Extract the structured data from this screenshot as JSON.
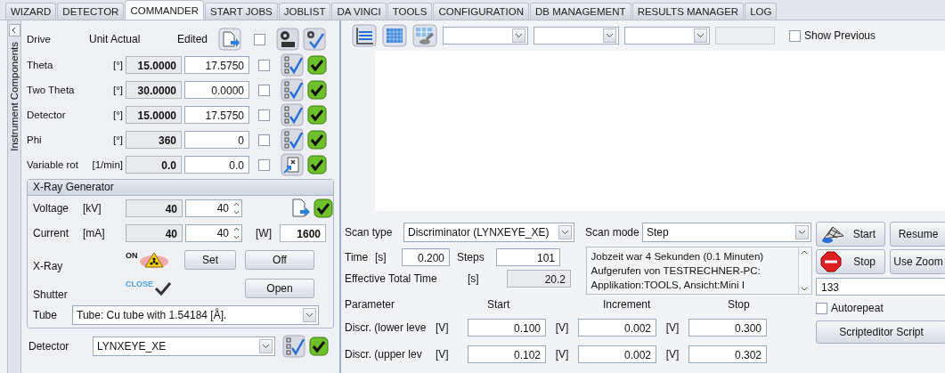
{
  "tabs": [
    {
      "label": "WIZARD",
      "selected": false
    },
    {
      "label": "DETECTOR",
      "selected": false
    },
    {
      "label": "COMMANDER",
      "selected": true
    },
    {
      "label": "START JOBS",
      "selected": false
    },
    {
      "label": "JOBLIST",
      "selected": false
    },
    {
      "label": "DA VINCI",
      "selected": false
    },
    {
      "label": "TOOLS",
      "selected": false
    },
    {
      "label": "CONFIGURATION",
      "selected": false
    },
    {
      "label": "DB MANAGEMENT",
      "selected": false
    },
    {
      "label": "RESULTS MANAGER",
      "selected": false
    },
    {
      "label": "LOG",
      "selected": false
    }
  ],
  "side_panel": {
    "title": "Instrument Components"
  },
  "drives": {
    "header": {
      "drive": "Drive",
      "unit_actual": "Unit Actual",
      "edited": "Edited",
      "checked": false
    },
    "rows": [
      {
        "name": "Theta",
        "unit": "[°]",
        "actual": "15.0000",
        "edited": "17.5750",
        "checked": false,
        "kind": "list"
      },
      {
        "name": "Two Theta",
        "unit": "[°]",
        "actual": "30.0000",
        "edited": "0.0000",
        "checked": false,
        "kind": "list"
      },
      {
        "name": "Detector",
        "unit": "[°]",
        "actual": "15.0000",
        "edited": "17.5750",
        "checked": false,
        "kind": "list"
      },
      {
        "name": "Phi",
        "unit": "[°]",
        "actual": "360",
        "edited": "0",
        "checked": false,
        "kind": "list"
      },
      {
        "name": "Variable rot",
        "unit": "[1/min]",
        "actual": "0.0",
        "edited": "0.0",
        "checked": false,
        "kind": "rot"
      }
    ]
  },
  "xray_generator": {
    "title": "X-Ray Generator",
    "voltage": {
      "label": "Voltage",
      "unit": "[kV]",
      "actual": "40",
      "set": "40"
    },
    "current": {
      "label": "Current",
      "unit": "[mA]",
      "actual": "40",
      "set": "40",
      "power_unit": "[W]",
      "power": "1600"
    },
    "xray": {
      "label": "X-Ray",
      "status": "ON",
      "set_button": "Set",
      "off_button": "Off"
    },
    "shutter": {
      "label": "Shutter",
      "status": "CLOSE",
      "open_button": "Open"
    },
    "tube": {
      "label": "Tube",
      "value": "Tube: Cu tube with 1.54184 [Å]."
    }
  },
  "detector": {
    "label": "Detector",
    "value": "LYNXEYE_XE"
  },
  "toolbar": {
    "show_previous": {
      "label": "Show Previous",
      "checked": false
    }
  },
  "scan": {
    "scan_type": {
      "label": "Scan type",
      "value": "Discriminator (LYNXEYE_XE)"
    },
    "scan_mode": {
      "label": "Scan mode",
      "value": "Step"
    },
    "time": {
      "label": "Time",
      "unit": "[s]",
      "value": "0.200"
    },
    "steps": {
      "label": "Steps",
      "value": "101"
    },
    "effective_total_time": {
      "label": "Effective Total Time",
      "unit": "[s]",
      "value": "20.2"
    },
    "log": [
      "Jobzeit war 4 Sekunden (0.1 Minuten)",
      "Aufgerufen von TESTRECHNER-PC:",
      "Applikation:TOOLS, Ansicht:Mini I"
    ],
    "start_button": "Start",
    "resume_button": "Resume",
    "stop_button": "Stop",
    "use_zoom_button": "Use Zoom",
    "counter": "133",
    "autorepeat": {
      "label": "Autorepeat",
      "checked": false
    },
    "scripteditor_button": "Scripteditor Script",
    "parameter_header": {
      "parameter": "Parameter",
      "start": "Start",
      "increment": "Increment",
      "stop": "Stop"
    },
    "parameters": [
      {
        "name": "Discr. (lower leve",
        "unit_start": "[V]",
        "start": "0.100",
        "unit_increment": "[V]",
        "increment": "0.002",
        "unit_stop": "[V]",
        "stop": "0.300"
      },
      {
        "name": "Discr. (upper lev",
        "unit_start": "[V]",
        "start": "0.102",
        "unit_increment": "[V]",
        "increment": "0.002",
        "unit_stop": "[V]",
        "stop": "0.302"
      }
    ]
  }
}
